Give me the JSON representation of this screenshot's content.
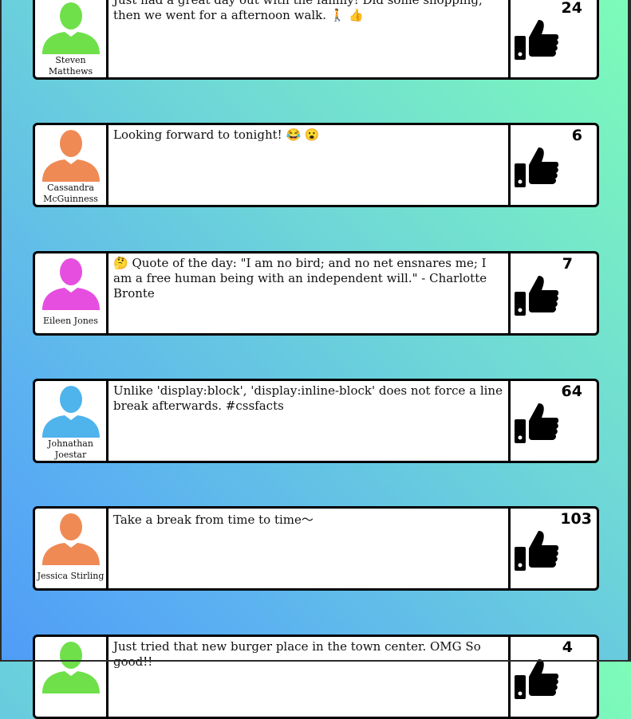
{
  "posts": [
    {
      "author": "Steven Matthews",
      "avatar_color": "#6fe04a",
      "message": "Just had a great day out with the family! Did some shopping, then we went for a afternoon walk. 🚶 👍",
      "likes": "24"
    },
    {
      "author": "Cassandra McGuinness",
      "avatar_color": "#ef8a55",
      "message": "Looking forward to tonight! 😂 😮",
      "likes": "6"
    },
    {
      "author": "Eileen Jones",
      "avatar_color": "#e64ee0",
      "message": "🤔 Quote of the day: \"I am no bird; and no net ensnares me; I am a free human being with an independent will.\" - Charlotte Bronte",
      "likes": "7"
    },
    {
      "author": "Johnathan Joestar",
      "avatar_color": "#4fb3ec",
      "message": "Unlike 'display:block', 'display:inline-block' does not force a line break afterwards. #cssfacts",
      "likes": "64"
    },
    {
      "author": "Jessica Stirling",
      "avatar_color": "#ef8a55",
      "message": "Take a break from time to time〜",
      "likes": "103"
    },
    {
      "author": "",
      "avatar_color": "#6fe04a",
      "message": "Just tried that new burger place in the town center. OMG So good!!",
      "likes": "4"
    }
  ],
  "icons": {
    "avatar": "person-silhouette-icon",
    "like": "thumbs-up-icon"
  }
}
